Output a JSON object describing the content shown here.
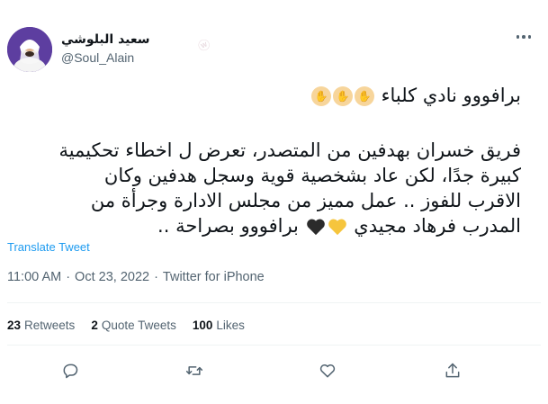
{
  "user": {
    "display_name": "سعيد البلوشي",
    "handle": "@Soul_Alain"
  },
  "tweet": {
    "line1": "برافووو نادي كلباء",
    "para": [
      "فريق خسران بهدفين من المتصدر، تعرض ل اخطاء تحكيمية",
      "كبيرة جدًا، لكن عاد بشخصية قوية وسجل هدفين وكان",
      "الاقرب للفوز .. عمل مميز من مجلس الادارة وجرأة من",
      "المدرب فرهاد مجيدي"
    ],
    "para_end": "برافووو بصراحة ..",
    "emojis_line1": [
      "clapping-hands",
      "clapping-hands",
      "clapping-hands"
    ],
    "emojis_line4": [
      "black-heart",
      "yellow-heart"
    ]
  },
  "translate_label": "Translate Tweet",
  "meta": {
    "time": "11:00 AM",
    "date": "Oct 23, 2022",
    "source": "Twitter for iPhone"
  },
  "stats": {
    "retweets_count": "23",
    "retweets_label": "Retweets",
    "quotes_count": "2",
    "quotes_label": "Quote Tweets",
    "likes_count": "100",
    "likes_label": "Likes"
  },
  "icons": {
    "reply": "reply-icon",
    "retweet": "retweet-icon",
    "like": "like-icon",
    "share": "share-icon",
    "more": "more-icon"
  },
  "colors": {
    "link": "#1d9bf0",
    "secondary": "#536471",
    "text": "#0f1419",
    "yellow_heart": "#f6c53d",
    "black_heart": "#2b2b2b"
  }
}
